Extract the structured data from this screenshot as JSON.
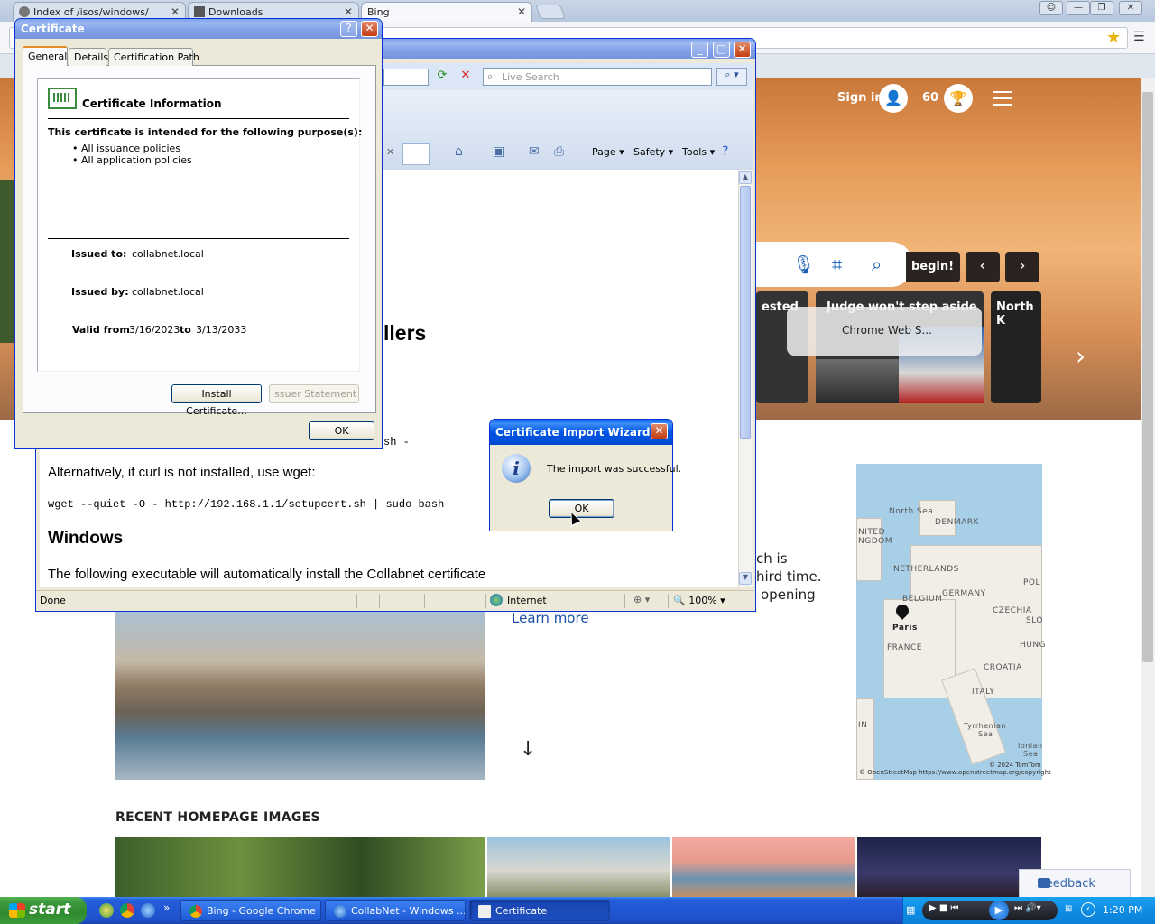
{
  "chrome": {
    "tabs": [
      {
        "label": "Index of /isos/windows/"
      },
      {
        "label": "Downloads"
      },
      {
        "label": "Bing"
      }
    ],
    "close_glyph": "✕"
  },
  "bing": {
    "signin": "Sign in",
    "points": "60",
    "search_begin": "begin!",
    "news": [
      {
        "title": "ested"
      },
      {
        "title": "Judge won't step aside"
      },
      {
        "title": "North K"
      }
    ],
    "chrome_popup": "Chrome Web S...",
    "text_fragments": [
      "ch is",
      "hird time.",
      "opening"
    ],
    "learn_more": "Learn more",
    "recent_title": "RECENT HOMEPAGE IMAGES",
    "feedback": "Feedback",
    "map": {
      "labels": [
        "North Sea",
        "DENMARK",
        "NITED",
        "NGDOM",
        "NETHERLANDS",
        "POL",
        "BELGIUM",
        "GERMANY",
        "CZECHIA",
        "SLO",
        "Paris",
        "FRANCE",
        "HUNG",
        "CROATIA",
        "ITALY",
        "IN",
        "Tyrrhenian",
        "Sea",
        "Ionian",
        "Sea"
      ],
      "credit1": "© 2024 TomTom",
      "credit2": "© OpenStreetMap https://www.openstreetmap.org/copyright"
    }
  },
  "ie": {
    "search_placeholder": "Live Search",
    "commands": [
      "Page",
      "Safety",
      "Tools"
    ],
    "heading_fragment": "llers",
    "code_fragment": "sh -",
    "alt_text": "Alternatively, if curl is not installed, use wget:",
    "wget_cmd": "wget --quiet -O - http://192.168.1.1/setupcert.sh | sudo bash",
    "windows_heading": "Windows",
    "windows_text": "The following executable will automatically install the Collabnet certificate",
    "status_done": "Done",
    "status_zone": "Internet",
    "zoom": "100%"
  },
  "cert": {
    "title": "Certificate",
    "tabs": [
      "General",
      "Details",
      "Certification Path"
    ],
    "info_title": "Certificate Information",
    "purpose_heading": "This certificate is intended for the following purpose(s):",
    "purposes": [
      "• All issuance policies",
      "• All application policies"
    ],
    "issued_to_label": "Issued to:",
    "issued_to": "collabnet.local",
    "issued_by_label": "Issued by:",
    "issued_by": "collabnet.local",
    "valid_from_label": "Valid from",
    "valid_from": "3/16/2023",
    "to_label": "to",
    "valid_to": "3/13/2033",
    "install_button": "Install Certificate...",
    "issuer_button": "Issuer Statement",
    "ok_button": "OK",
    "help_glyph": "?"
  },
  "wizard": {
    "title": "Certificate Import Wizard",
    "message": "The import was successful.",
    "ok_button": "OK"
  },
  "taskbar": {
    "start": "start",
    "items": [
      {
        "label": "Bing - Google Chrome"
      },
      {
        "label": "CollabNet - Windows ..."
      },
      {
        "label": "Certificate"
      }
    ],
    "overflow": "»",
    "clock": "1:20 PM"
  },
  "colors": {
    "xp_blue": "#0054e3",
    "xp_face": "#ece9d8",
    "taskbar_blue": "#245edb",
    "start_green": "#3c9a3c",
    "bing_link": "#1a4fa8"
  },
  "icons": [
    "search-icon",
    "microphone-icon",
    "visual-search-icon",
    "trophy-icon",
    "user-icon",
    "star-icon",
    "info-icon",
    "certificate-icon",
    "home-icon",
    "print-icon",
    "help-icon",
    "globe-icon"
  ]
}
